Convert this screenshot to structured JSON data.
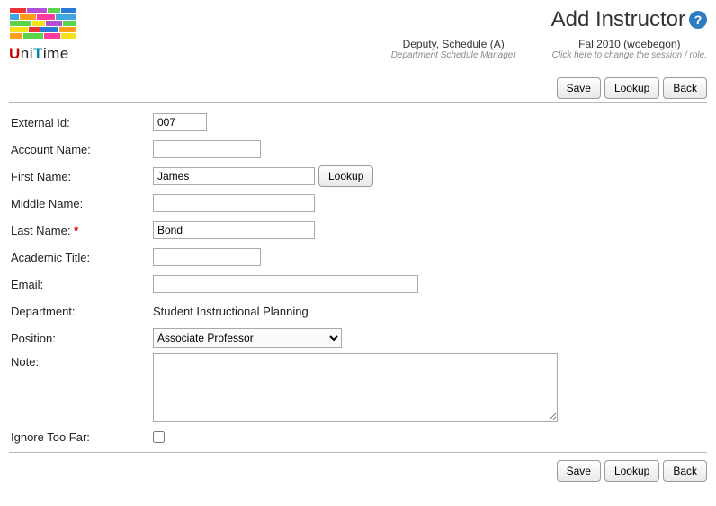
{
  "header": {
    "logo_text": {
      "u": "U",
      "ni": "NI",
      "t": "T",
      "ime": "IME"
    },
    "title": "Add Instructor",
    "session1": {
      "top": "Deputy, Schedule (A)",
      "sub": "Department Schedule Manager"
    },
    "session2": {
      "top": "Fal 2010 (woebegon)",
      "sub": "Click here to change the session / role."
    }
  },
  "buttons": {
    "save": "Save",
    "lookup": "Lookup",
    "back": "Back"
  },
  "form": {
    "labels": {
      "external_id": "External Id:",
      "account_name": "Account Name:",
      "first_name": "First Name:",
      "middle_name": "Middle Name:",
      "last_name": "Last Name:",
      "academic_title": "Academic Title:",
      "email": "Email:",
      "department": "Department:",
      "position": "Position:",
      "note": "Note:",
      "ignore_too_far": "Ignore Too Far:"
    },
    "values": {
      "external_id": "007",
      "account_name": "",
      "first_name": "James",
      "middle_name": "",
      "last_name": "Bond",
      "academic_title": "",
      "email": "",
      "department": "Student Instructional Planning",
      "position_selected": "Associate Professor",
      "note": "",
      "ignore_too_far": false
    },
    "required_marker": "*"
  }
}
